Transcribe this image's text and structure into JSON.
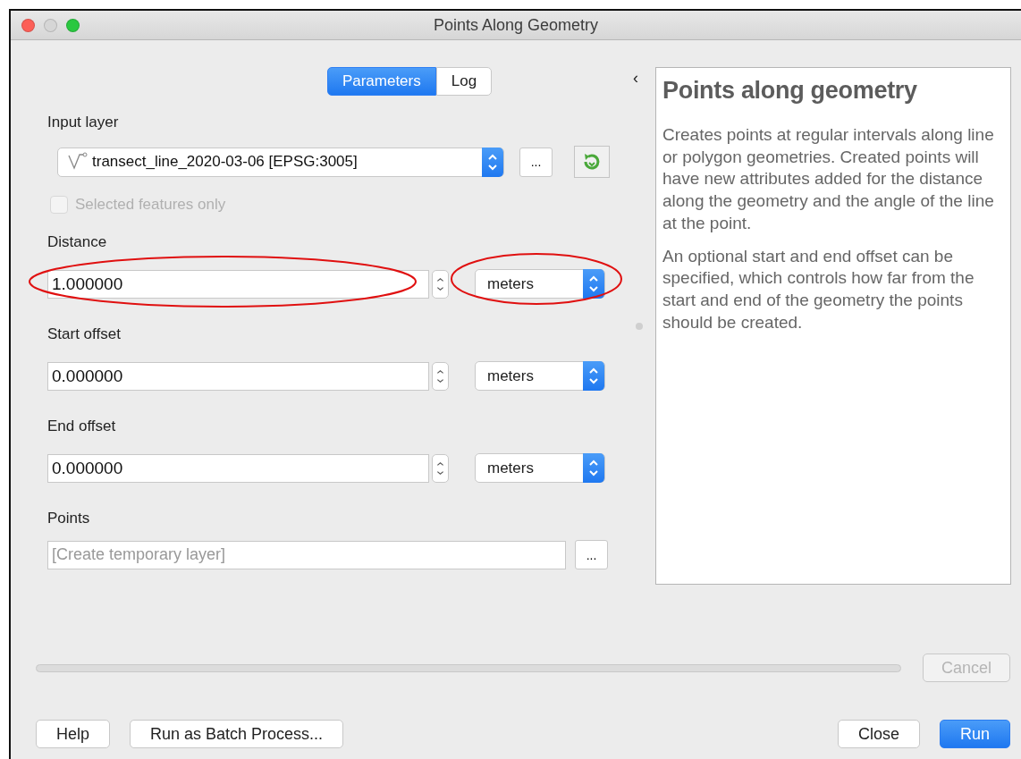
{
  "window": {
    "title": "Points Along Geometry"
  },
  "tabs": [
    {
      "label": "Parameters",
      "selected": true
    },
    {
      "label": "Log",
      "selected": false
    }
  ],
  "input_layer": {
    "label": "Input layer",
    "value": "transect_line_2020-03-06 [EPSG:3005]",
    "browse": "...",
    "selected_only": {
      "label": "Selected features only",
      "checked": false,
      "disabled": true
    }
  },
  "numeric_params": [
    {
      "label": "Distance",
      "value": "1.000000",
      "unit": "meters",
      "circled": true
    },
    {
      "label": "Start offset",
      "value": "0.000000",
      "unit": "meters",
      "circled": false
    },
    {
      "label": "End offset",
      "value": "0.000000",
      "unit": "meters",
      "circled": false
    }
  ],
  "output": {
    "label": "Points",
    "placeholder": "[Create temporary layer]",
    "browse": "..."
  },
  "help_panel": {
    "collapse": "‹",
    "title": "Points along geometry",
    "paragraphs": [
      "Creates points at regular intervals along line or polygon geometries. Created points will have new attributes added for the distance along the geometry and the angle of the line at the point.",
      "An optional start and end offset can be specified, which controls how far from the start and end of the geometry the points should be created."
    ]
  },
  "progress": {
    "level": 0
  },
  "cancel": {
    "label": "Cancel",
    "disabled": true
  },
  "buttons": [
    {
      "label": "Help",
      "primary": false
    },
    {
      "label": "Run as Batch Process...",
      "primary": false
    },
    {
      "label": "Close",
      "primary": false
    },
    {
      "label": "Run",
      "primary": true
    }
  ]
}
